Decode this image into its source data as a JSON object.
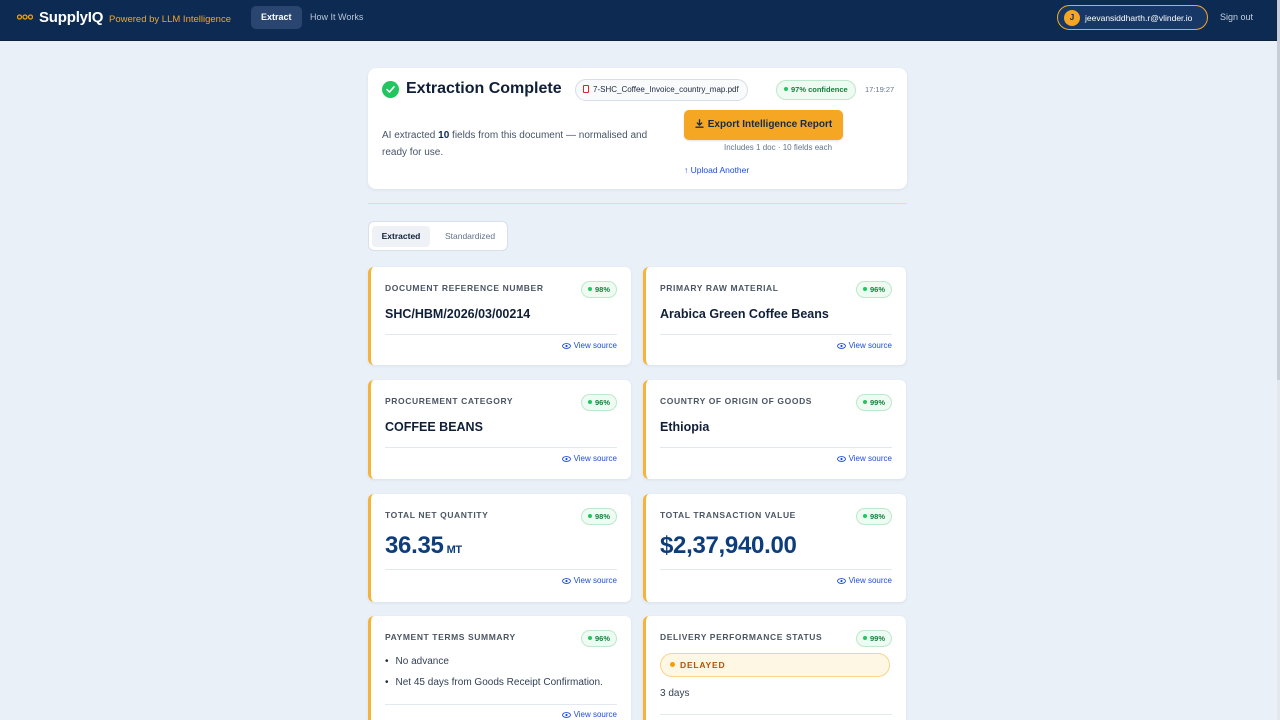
{
  "header": {
    "brand": "SupplyIQ",
    "tagline": "Powered by LLM Intelligence",
    "nav": [
      {
        "label": "Extract",
        "active": true
      },
      {
        "label": "How It Works",
        "active": false
      }
    ],
    "user": {
      "initial": "J",
      "email": "jeevansiddharth.r@vlinder.io"
    },
    "signout_label": "Sign out"
  },
  "summary": {
    "title": "Extraction Complete",
    "file_name": "7-SHC_Coffee_Invoice_country_map.pdf",
    "confidence": "97% confidence",
    "time": "17:19:27",
    "desc_prefix": "AI extracted",
    "field_count": "10",
    "desc_suffix": "fields from this document — normalised and ready for use.",
    "export_label": "Export Intelligence Report",
    "export_note": "Includes 1 doc · 10 fields each",
    "upload_label": "↑ Upload Another"
  },
  "view_tabs": [
    {
      "label": "Extracted",
      "active": true
    },
    {
      "label": "Standardized",
      "active": false
    }
  ],
  "view_source_label": "View source",
  "fields": {
    "doc_ref": {
      "label": "DOCUMENT REFERENCE NUMBER",
      "confidence": "98%",
      "value": "SHC/HBM/2026/03/00214"
    },
    "raw_material": {
      "label": "PRIMARY RAW MATERIAL",
      "confidence": "96%",
      "value": "Arabica Green Coffee Beans"
    },
    "category": {
      "label": "PROCUREMENT CATEGORY",
      "confidence": "96%",
      "value": "COFFEE BEANS"
    },
    "origin": {
      "label": "COUNTRY OF ORIGIN OF GOODS",
      "confidence": "99%",
      "value": "Ethiopia"
    },
    "quantity": {
      "label": "TOTAL NET QUANTITY",
      "confidence": "98%",
      "value": "36.35",
      "unit": "MT"
    },
    "txn_value": {
      "label": "TOTAL TRANSACTION VALUE",
      "confidence": "98%",
      "value": "$2,37,940.00"
    },
    "payment": {
      "label": "PAYMENT TERMS SUMMARY",
      "confidence": "96%",
      "items": [
        "No advance",
        "Net 45 days from Goods Receipt Confirmation."
      ]
    },
    "delivery": {
      "label": "DELIVERY PERFORMANCE STATUS",
      "confidence": "99%",
      "status": "DELAYED",
      "detail": "3 days"
    }
  },
  "colors": {
    "header_bg": "#0d2a52",
    "accent": "#f5a623",
    "success": "#22c55e",
    "link": "#1d4ed8",
    "warning": "#b45309"
  }
}
